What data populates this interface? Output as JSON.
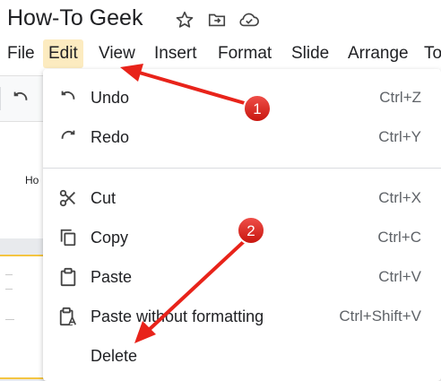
{
  "document": {
    "title": "How-To Geek"
  },
  "menubar": {
    "items": [
      "File",
      "Edit",
      "View",
      "Insert",
      "Format",
      "Slide",
      "Arrange",
      "To"
    ]
  },
  "slide_panel": {
    "thumb_text": "Ho"
  },
  "edit_menu": {
    "items": [
      {
        "label": "Undo",
        "shortcut": "Ctrl+Z",
        "icon": "undo-icon"
      },
      {
        "label": "Redo",
        "shortcut": "Ctrl+Y",
        "icon": "redo-icon"
      },
      {
        "label": "Cut",
        "shortcut": "Ctrl+X",
        "icon": "scissors-icon"
      },
      {
        "label": "Copy",
        "shortcut": "Ctrl+C",
        "icon": "copy-icon"
      },
      {
        "label": "Paste",
        "shortcut": "Ctrl+V",
        "icon": "clipboard-icon"
      },
      {
        "label": "Paste without formatting",
        "shortcut": "Ctrl+Shift+V",
        "icon": "paste-plain-icon"
      },
      {
        "label": "Delete",
        "shortcut": "",
        "icon": ""
      }
    ]
  },
  "annotations": {
    "badge_1": "1",
    "badge_2": "2",
    "color": "#e8231a"
  }
}
